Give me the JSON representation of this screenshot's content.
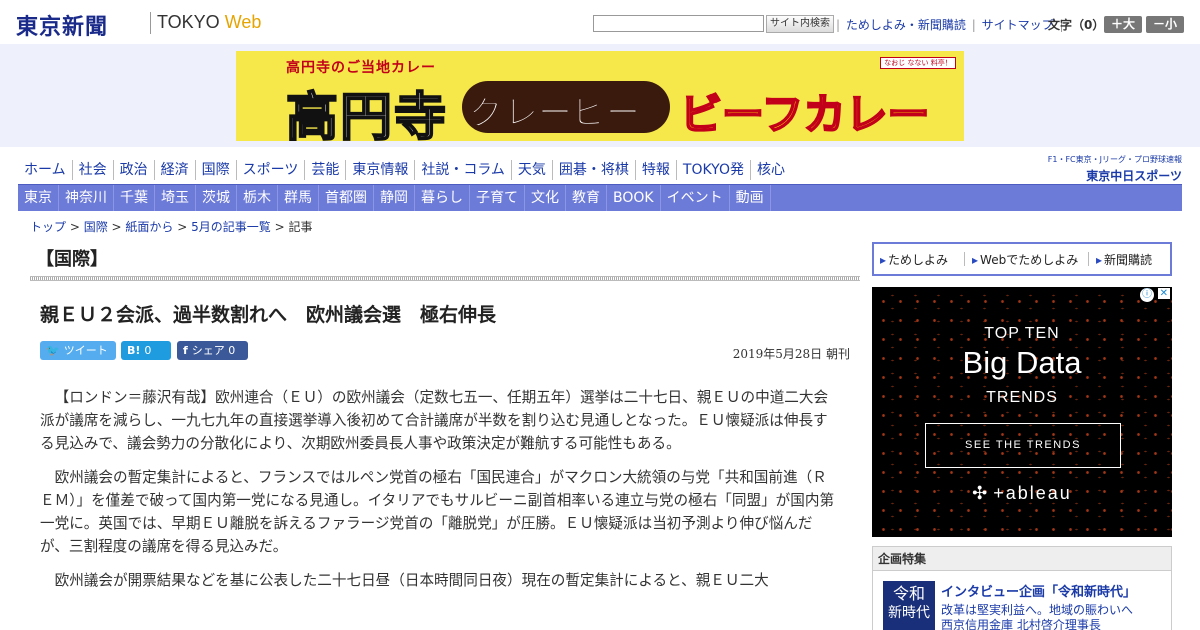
{
  "header": {
    "logo": "東京新聞",
    "logo_en_1": "TOKYO",
    "logo_en_2": "Web",
    "search_button": "サイト内検索",
    "links": [
      "ためしよみ・新聞購読",
      "サイトマップ"
    ],
    "font_label": "文字（0）",
    "font_larger": "＋大",
    "font_smaller": "－小"
  },
  "banner": {
    "subtitle": "高円寺のご当地カレー",
    "main_1": "高円寺",
    "main_2": "グレービー",
    "main_3": "ビーフカレー",
    "tag": "なおじ なない 料亭！"
  },
  "nav_primary": [
    "ホーム",
    "社会",
    "政治",
    "経済",
    "国際",
    "スポーツ",
    "芸能",
    "東京情報",
    "社説・コラム",
    "天気",
    "囲碁・将棋",
    "特報",
    "TOKYO発",
    "核心"
  ],
  "nav_secondary": [
    "東京",
    "神奈川",
    "千葉",
    "埼玉",
    "茨城",
    "栃木",
    "群馬",
    "首都圏",
    "静岡",
    "暮らし",
    "子育て",
    "文化",
    "教育",
    "BOOK",
    "イベント",
    "動画"
  ],
  "chunichi": {
    "line1": "F1・FC東京・Jリーグ・プロ野球速報",
    "line2": "東京中日スポーツ"
  },
  "breadcrumb": {
    "items": [
      "トップ",
      "国際",
      "紙面から",
      "5月の記事一覧"
    ],
    "current": "記事",
    "sep": " > "
  },
  "article": {
    "section": "【国際】",
    "headline": "親ＥＵ２会派、過半数割れへ　欧州議会選　極右伸長",
    "date": "2019年5月28日 朝刊",
    "share_tweet": "ツイート",
    "share_hatena_icon": "B!",
    "share_hatena_count": "0",
    "share_fb_label": "シェア",
    "share_fb_count": "0",
    "paragraphs": [
      "【ロンドン＝藤沢有哉】欧州連合（ＥＵ）の欧州議会（定数七五一、任期五年）選挙は二十七日、親ＥＵの中道二大会派が議席を減らし、一九七九年の直接選挙導入後初めて合計議席が半数を割り込む見通しとなった。ＥＵ懐疑派は伸長する見込みで、議会勢力の分散化により、次期欧州委員長人事や政策決定が難航する可能性もある。",
      "欧州議会の暫定集計によると、フランスではルペン党首の極右「国民連合」がマクロン大統領の与党「共和国前進（ＲＥＭ）」を僅差で破って国内第一党になる見通し。イタリアでもサルビーニ副首相率いる連立与党の極右「同盟」が国内第一党に。英国では、早期ＥＵ離脱を訴えるファラージ党首の「離脱党」が圧勝。ＥＵ懐疑派は当初予測より伸び悩んだが、三割程度の議席を得る見込みだ。",
      "欧州議会が開票結果などを基に公表した二十七日昼（日本時間同日夜）現在の暫定集計によると、親ＥＵ二大"
    ]
  },
  "sidebar": {
    "tabs": [
      "ためしよみ",
      "Webでためしよみ",
      "新聞購読"
    ],
    "ad": {
      "line1": "TOP TEN",
      "line2": "Big Data",
      "line3": "TRENDS",
      "button": "SEE THE TRENDS",
      "logo": "+ableau"
    },
    "feature": {
      "heading": "企画特集",
      "thumb_1": "令和",
      "thumb_2": "新時代",
      "title": "インタビュー企画「令和新時代」",
      "desc_1": "改革は堅実利益へ。地域の賑わいへ",
      "desc_2": "西京信用金庫 北村啓介理事長"
    }
  },
  "colors": {
    "brand": "#1a2a8a",
    "nav_bar": "#6d7bd8",
    "link": "#1a3aa8",
    "banner_bg": "#eef0fb"
  }
}
